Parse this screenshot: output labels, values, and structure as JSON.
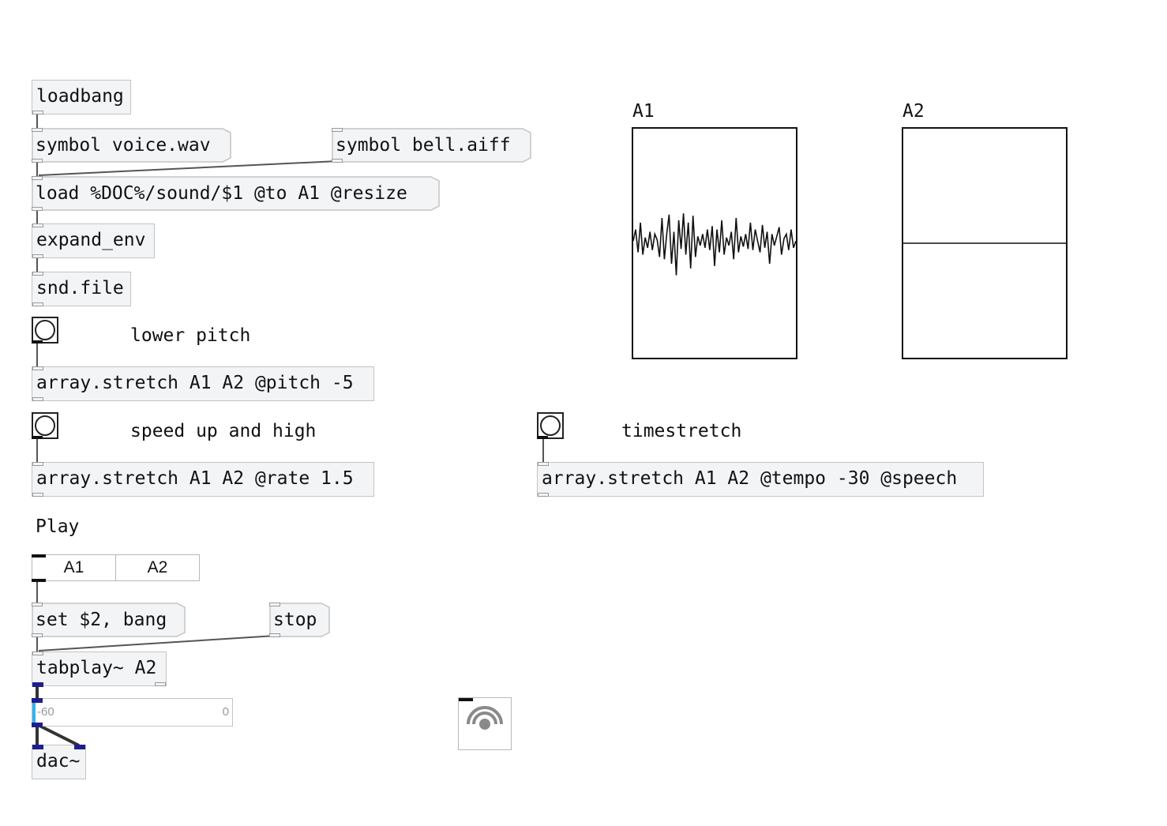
{
  "objects": {
    "loadbang": "loadbang",
    "msg_voice": "symbol voice.wav",
    "msg_bell": "symbol bell.aiff",
    "msg_load": "load %DOC%/sound/$1 @to A1 @resize",
    "expand_env": "expand_env",
    "snd_file": "snd.file",
    "stretch_pitch": "array.stretch A1 A2 @pitch -5",
    "stretch_rate": "array.stretch A1 A2 @rate 1.5",
    "stretch_tempo": "array.stretch A1 A2 @tempo -30 @speech",
    "msg_set": "set $2, bang",
    "msg_stop": "stop",
    "tabplay": "tabplay~ A2",
    "dac": "dac~"
  },
  "comments": {
    "lower_pitch": "lower pitch",
    "speed_up": "speed up and high",
    "timestretch": "timestretch",
    "play": "Play"
  },
  "tabs": [
    "A1",
    "A2"
  ],
  "arrays": {
    "a1": {
      "label": "A1",
      "waveform": [
        0.02,
        0.12,
        -0.08,
        0.18,
        -0.1,
        0.05,
        -0.04,
        0.1,
        -0.06,
        0.08,
        0.03,
        -0.12,
        0.22,
        -0.14,
        0.08,
        0.25,
        -0.18,
        0.1,
        -0.28,
        0.2,
        -0.05,
        0.26,
        -0.1,
        0.18,
        -0.22,
        0.24,
        -0.12,
        0.06,
        -0.02,
        0.08,
        -0.04,
        0.12,
        -0.06,
        0.15,
        -0.2,
        0.12,
        -0.08,
        0.2,
        -0.1,
        0.05,
        -0.02,
        0.1,
        -0.14,
        0.22,
        -0.08,
        0.06,
        -0.03,
        0.08,
        -0.05,
        0.18,
        -0.06,
        0.12,
        0.02,
        -0.08,
        0.16,
        -0.04,
        0.1,
        -0.18,
        0.08,
        -0.02,
        0.06,
        0.14,
        -0.1,
        0.04,
        0.08,
        -0.06,
        0.12,
        -0.04,
        0.02
      ]
    },
    "a2": {
      "label": "A2",
      "waveform": [
        0,
        0
      ]
    }
  },
  "meter": {
    "min_label": "-60",
    "max_label": "0",
    "level": 0.0
  },
  "icons": {
    "speaker": "speaker-icon",
    "bang": "bang-circle-icon"
  }
}
